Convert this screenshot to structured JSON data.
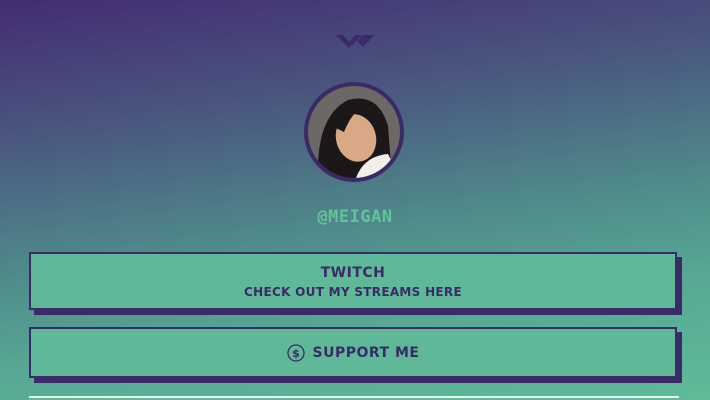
{
  "profile": {
    "username": "@MEIGAN"
  },
  "links": [
    {
      "title": "TWITCH",
      "subtitle": "CHECK OUT MY STREAMS HERE"
    },
    {
      "title": "SUPPORT ME",
      "icon": "dollar-coin-icon"
    }
  ],
  "colors": {
    "accent": "#5fb998",
    "dark": "#3b2a68",
    "username": "#63c39a"
  }
}
